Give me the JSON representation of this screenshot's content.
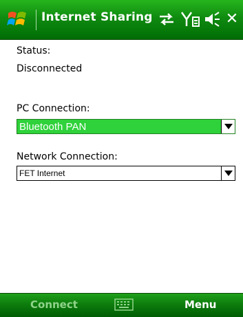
{
  "window": {
    "title": "Internet Sharing",
    "close_label": "✕"
  },
  "status": {
    "label": "Status:",
    "value": "Disconnected"
  },
  "pc_connection": {
    "label": "PC Connection:",
    "selected": "Bluetooth PAN"
  },
  "network_connection": {
    "label": "Network Connection:",
    "selected": "FET Internet"
  },
  "softkeys": {
    "left": "Connect",
    "right": "Menu"
  },
  "icons": {
    "start": "windows-start-icon",
    "sync": "connection-sync-icon",
    "signal": "signal-strength-icon",
    "sound": "speaker-icon",
    "keyboard": "keyboard-icon"
  },
  "colors": {
    "titlebar": "#0f8b10",
    "selected_combo": "#2fd23a"
  }
}
